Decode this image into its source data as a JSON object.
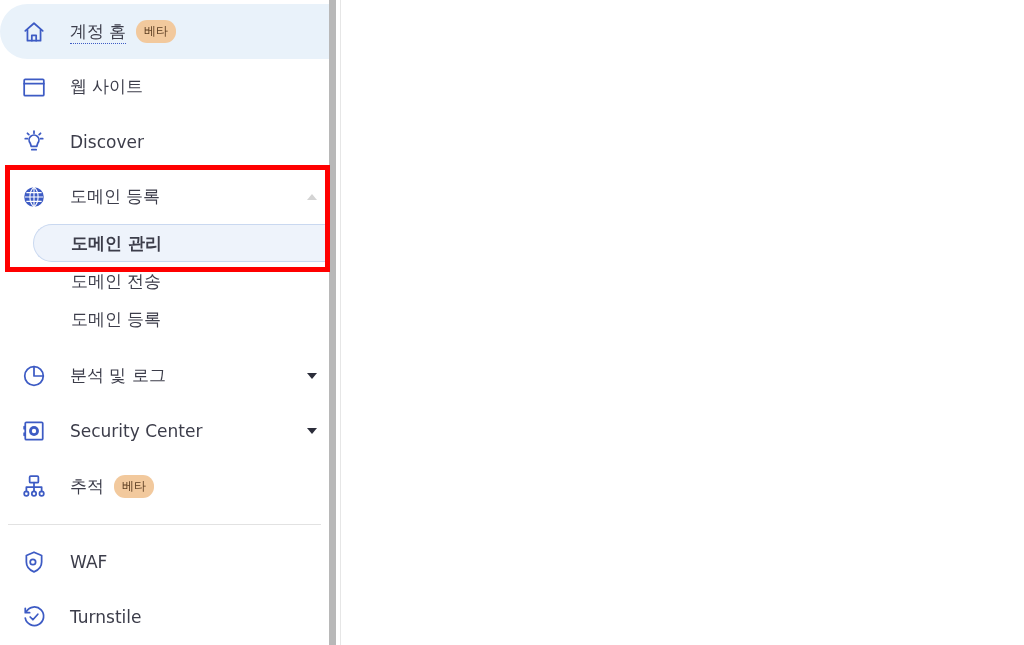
{
  "sidebar": {
    "sections": [
      {
        "items": [
          {
            "kind": "link",
            "label": "계정 홈",
            "badge": "베타",
            "selected": true
          },
          {
            "kind": "link",
            "label": "웹 사이트",
            "selected": false
          },
          {
            "kind": "link",
            "label": "Discover",
            "selected": false
          },
          {
            "kind": "group",
            "label": "도메인 등록",
            "expanded": true,
            "selected": false,
            "boxed": true,
            "children": [
              {
                "label": "도메인 관리",
                "selected": true,
                "boxed": true
              },
              {
                "label": "도메인 전송",
                "selected": false,
                "boxed": false
              },
              {
                "label": "도메인 등록",
                "selected": false,
                "boxed": false
              }
            ]
          },
          {
            "kind": "group",
            "label": "분석 및 로그",
            "expanded": false,
            "selected": false,
            "boxed": false
          },
          {
            "kind": "group",
            "label": "Security Center",
            "expanded": false,
            "selected": false,
            "boxed": false
          },
          {
            "kind": "link",
            "label": "추적",
            "badge": "베타",
            "selected": false
          }
        ]
      },
      {
        "items": [
          {
            "kind": "link",
            "label": "WAF",
            "selected": false
          },
          {
            "kind": "link",
            "label": "Turnstile",
            "selected": false
          }
        ]
      }
    ]
  },
  "annotation": {
    "color": "#ff0000"
  }
}
